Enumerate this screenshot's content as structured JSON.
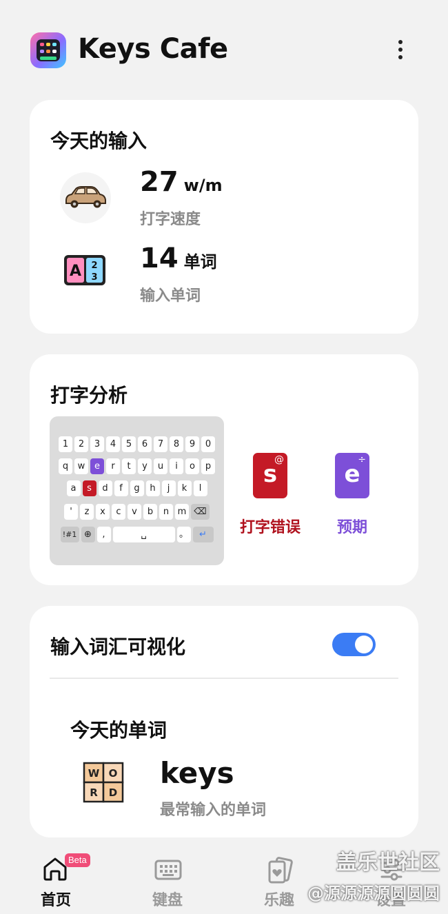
{
  "header": {
    "app_title": "Keys Cafe",
    "menu_icon": "more-vertical-icon"
  },
  "today_input": {
    "title": "今天的输入",
    "speed_value": "27",
    "speed_unit": "w/m",
    "speed_label": "打字速度",
    "words_value": "14",
    "words_unit": "单词",
    "words_label": "输入单词"
  },
  "typing_analysis": {
    "title": "打字分析",
    "keyboard_rows": [
      [
        "1",
        "2",
        "3",
        "4",
        "5",
        "6",
        "7",
        "8",
        "9",
        "0"
      ],
      [
        "q",
        "w",
        "e",
        "r",
        "t",
        "y",
        "u",
        "i",
        "o",
        "p"
      ],
      [
        "a",
        "s",
        "d",
        "f",
        "g",
        "h",
        "j",
        "k",
        "l"
      ],
      [
        "'",
        "z",
        "x",
        "c",
        "v",
        "b",
        "n",
        "m",
        "⌫"
      ],
      [
        "!#1",
        "⊕",
        ",",
        "␣",
        "。",
        "↵"
      ]
    ],
    "error_key": "s",
    "error_superscript": "@",
    "error_label": "打字错误",
    "predict_key": "e",
    "predict_superscript": "÷",
    "predict_label": "预期",
    "error_color": "#c41a26",
    "predict_color": "#7d4fd8"
  },
  "vocab": {
    "title": "输入词汇可视化",
    "toggle_on": true,
    "word_of_day_title": "今天的单词",
    "top_word": "keys",
    "top_word_label": "最常输入的单词"
  },
  "bottom_nav": {
    "items": [
      {
        "label": "首页",
        "icon": "home-icon",
        "active": true,
        "badge": "Beta"
      },
      {
        "label": "键盘",
        "icon": "keyboard-icon",
        "active": false
      },
      {
        "label": "乐趣",
        "icon": "cards-icon",
        "active": false
      },
      {
        "label": "设置",
        "icon": "settings-icon",
        "active": false
      }
    ]
  },
  "watermark": {
    "line1": "盖乐世社区",
    "line2": "@源源源源圆圆圆"
  },
  "colors": {
    "toggle": "#3b7cf4",
    "beta_badge": "#f04d78"
  }
}
